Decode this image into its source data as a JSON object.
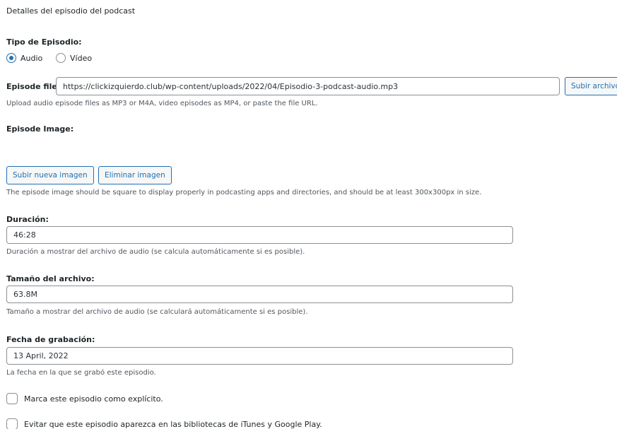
{
  "header": {
    "title": "Detalles del episodio del podcast"
  },
  "episode_type": {
    "label": "Tipo de Episodio:",
    "options": [
      {
        "label": "Audio",
        "checked": true
      },
      {
        "label": "Vídeo",
        "checked": false
      }
    ]
  },
  "episode_file": {
    "label": "Episode file:",
    "value": "https://clickizquierdo.club/wp-content/uploads/2022/04/Episodio-3-podcast-audio.mp3",
    "upload_button": "Subir archivo",
    "help": "Upload audio episode files as MP3 or M4A, video episodes as MP4, or paste the file URL."
  },
  "episode_image": {
    "label": "Episode Image:",
    "upload_button": "Subir nueva imagen",
    "remove_button": "Eliminar imagen",
    "help": "The episode image should be square to display properly in podcasting apps and directories, and should be at least 300x300px in size."
  },
  "duration": {
    "label": "Duración:",
    "value": "46:28",
    "help": "Duración a mostrar del archivo de audio (se calcula automáticamente si es posible)."
  },
  "file_size": {
    "label": "Tamaño del archivo:",
    "value": "63.8M",
    "help": "Tamaño a mostrar del archivo de audio (se calculará automáticamente si es posible)."
  },
  "record_date": {
    "label": "Fecha de grabación:",
    "value": "13 April, 2022",
    "help": "La fecha en la que se grabó este episodio."
  },
  "checkboxes": [
    {
      "label": "Marca este episodio como explícito.",
      "checked": false
    },
    {
      "label": "Evitar que este episodio aparezca en las bibliotecas de iTunes y Google Play.",
      "checked": false
    }
  ]
}
